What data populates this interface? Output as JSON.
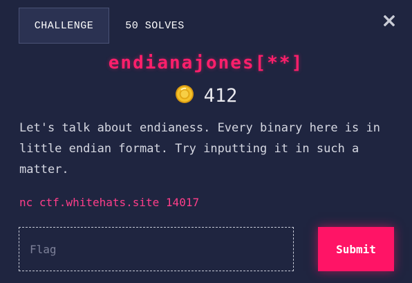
{
  "tabs": {
    "challenge": "CHALLENGE",
    "solves": "50 SOLVES"
  },
  "close_icon": "close-icon",
  "challenge": {
    "name": "endianajones[**]",
    "points": "412",
    "points_icon": "coin-icon",
    "description": "Let's talk about endianess. Every binary here is in\nlittle endian format. Try inputting it in such a\nmatter.",
    "connection": "nc ctf.whitehats.site 14017"
  },
  "form": {
    "flag_placeholder": "Flag",
    "flag_value": "",
    "submit_label": "Submit"
  },
  "colors": {
    "background": "#1f2540",
    "accent": "#ff1466",
    "link": "#ff3e8a",
    "coin": "#f2b61d"
  }
}
